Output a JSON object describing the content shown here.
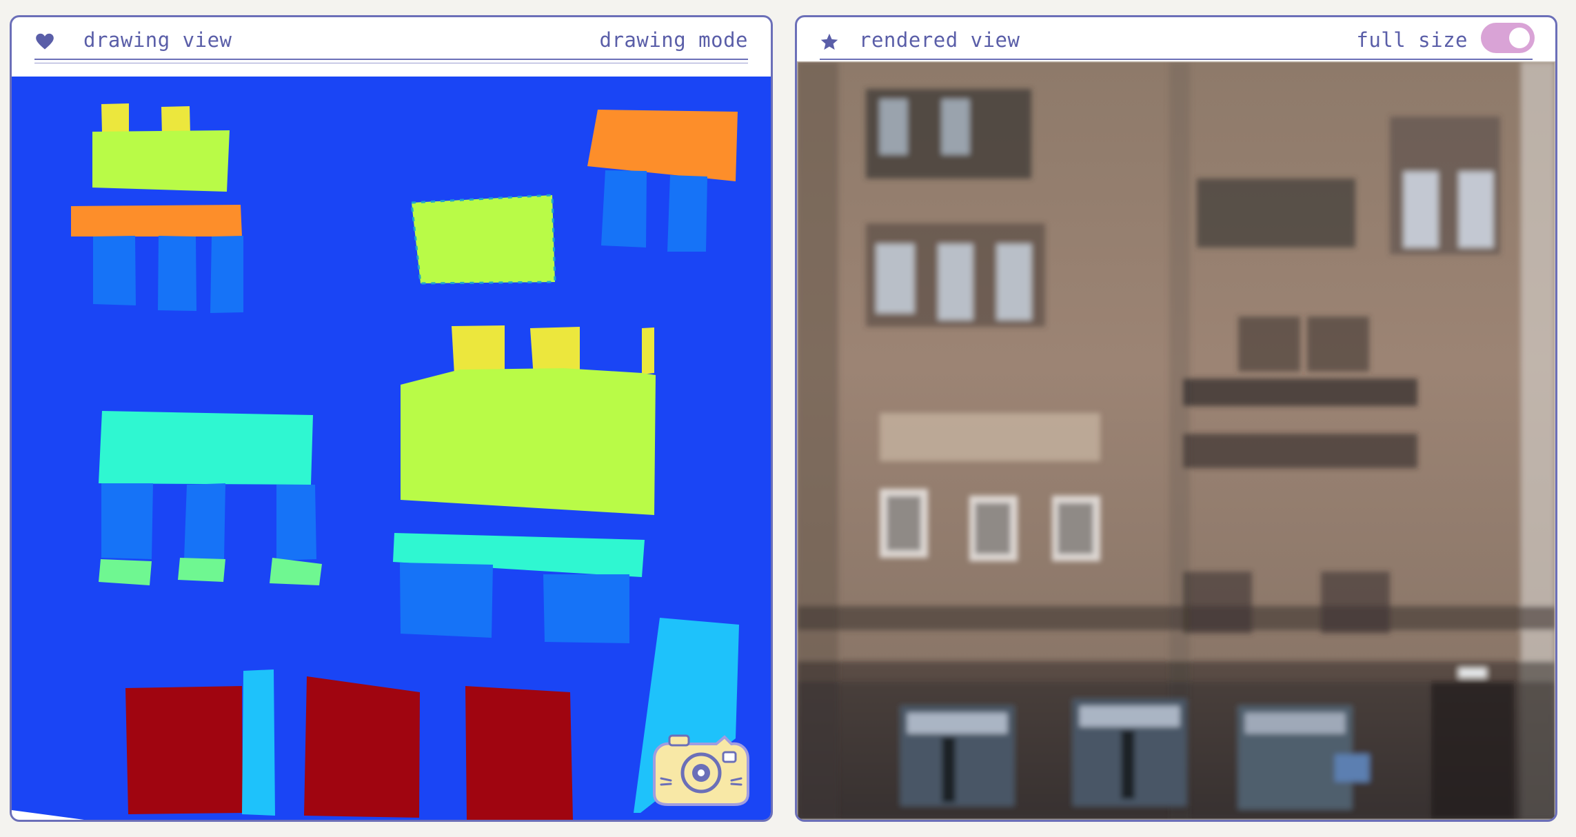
{
  "left_panel": {
    "title": "drawing view",
    "mode_label": "drawing mode",
    "icon": "heart-icon"
  },
  "right_panel": {
    "title": "rendered view",
    "toggle_label": "full size",
    "toggle_on": true,
    "icon": "star-icon"
  },
  "colors": {
    "accent": "#6b6fb8",
    "text": "#5a5ea8",
    "toggle": "#d9a3d6",
    "canvas_background": "#1a45f5",
    "label_yellow_green": "#b9fb47",
    "label_yellow": "#ece73d",
    "label_orange": "#fd8e2a",
    "label_blue": "#1673f7",
    "label_cyan_green": "#2ff7d1",
    "label_light_green": "#6ff791",
    "label_dark_red": "#a00510",
    "label_sky": "#1ec2fb"
  },
  "camera_button": {
    "icon": "camera-icon"
  }
}
